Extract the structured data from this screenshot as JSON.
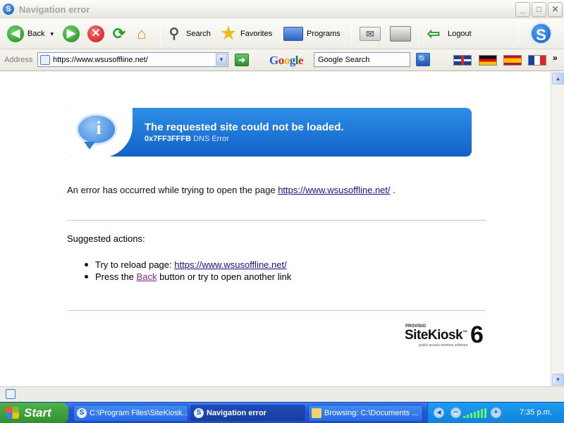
{
  "window": {
    "title": "Navigation error",
    "app_icon_letter": "S"
  },
  "window_buttons": {
    "minimize": "_",
    "maximize": "□",
    "close": "✕"
  },
  "toolbar": {
    "back_label": "Back",
    "back_dropdown": "▾",
    "search_label": "Search",
    "favorites_label": "Favorites",
    "programs_label": "Programs",
    "logout_label": "Logout",
    "brand_letter": "S"
  },
  "address": {
    "label": "Address",
    "value": "https://www.wsusoffline.net/",
    "dropdown": "▾",
    "go": "➜"
  },
  "google": {
    "logo": "Google",
    "search_value": "Google Search",
    "search_button": "🔍"
  },
  "languages": [
    "uk-flag",
    "german-flag",
    "spanish-flag",
    "french-flag"
  ],
  "more_chevron": "»",
  "error": {
    "title": "The requested site could not be loaded.",
    "code": "0x7FF3FFFB",
    "code_desc": "DNS Error",
    "message_prefix": "An error has occurred while trying to open the page",
    "url": "https://www.wsusoffline.net/",
    "message_suffix": "."
  },
  "suggestions": {
    "heading": "Suggested actions:",
    "reload_prefix": "Try to reload page:",
    "reload_url": "https://www.wsusoffline.net/",
    "press_prefix": "Press the",
    "back_link": "Back",
    "press_suffix": "button or try to open another link"
  },
  "sitekiosk": {
    "provisio": "PROVISIO",
    "name": "SiteKiosk",
    "tm": "™",
    "version": "6",
    "tagline": "public access terminal software"
  },
  "scrollbar": {
    "up": "▲",
    "down": "▼"
  },
  "taskbar": {
    "start_label": "Start",
    "tasks": [
      {
        "label": "C:\\Program Files\\SiteKiosk..."
      },
      {
        "label": "Navigation error"
      },
      {
        "label": "Browsing: C:\\Documents ..."
      }
    ],
    "tray_left": "◂",
    "tray_minus": "−",
    "tray_plus": "+",
    "clock": "7:35 p.m."
  },
  "colors": {
    "banner": "#1f74d6",
    "link": "#1b0f8f",
    "visited_link": "#7a2b84",
    "taskbar": "#2456d6",
    "start": "#3a9e37"
  }
}
